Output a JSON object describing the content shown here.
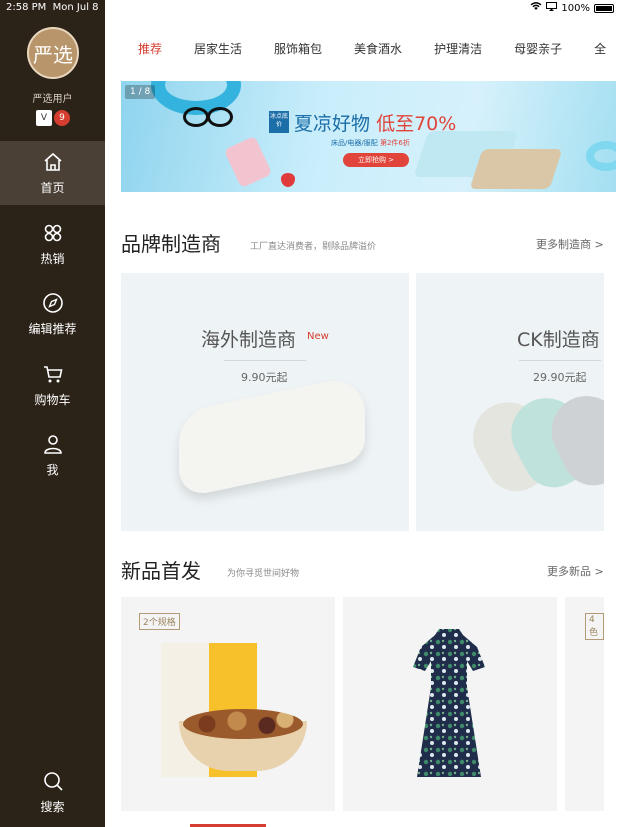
{
  "status_bar": {
    "time": "2:58 PM",
    "date": "Mon Jul 8",
    "battery": "100%"
  },
  "sidebar": {
    "avatar_text": "严选",
    "username": "严选用户",
    "badge_left": "V",
    "badge_right": "9",
    "items": [
      {
        "label": "首页",
        "icon": "home-icon",
        "active": true
      },
      {
        "label": "热销",
        "icon": "clover-icon",
        "active": false
      },
      {
        "label": "编辑推荐",
        "icon": "compass-icon",
        "active": false
      },
      {
        "label": "购物车",
        "icon": "cart-icon",
        "active": false
      },
      {
        "label": "我",
        "icon": "user-icon",
        "active": false
      }
    ],
    "search_label": "搜索"
  },
  "tabs": [
    "推荐",
    "居家生活",
    "服饰箱包",
    "美食酒水",
    "护理清洁",
    "母婴亲子",
    "全"
  ],
  "banner": {
    "counter": "1 / 8",
    "tag": "冰点底价",
    "title_main": "夏凉好物",
    "title_red": "低至70%",
    "subtitle": "床品/电器/服配",
    "subtitle_red": "第2件6折",
    "button": "立即抢购 >"
  },
  "brand_section": {
    "title": "品牌制造商",
    "subtitle": "工厂直达消费者，剔除品牌溢价",
    "more": "更多制造商 >",
    "cards": [
      {
        "name": "海外制造商",
        "badge": "New",
        "price": "9.90元起"
      },
      {
        "name": "CK制造商",
        "price": "29.90元起"
      }
    ]
  },
  "new_section": {
    "title": "新品首发",
    "subtitle": "为你寻觅世间好物",
    "more": "更多新品 >",
    "cards": [
      {
        "spec": "2个规格"
      },
      {
        "spec": ""
      },
      {
        "spec": "4色"
      }
    ]
  },
  "colors": {
    "sidebar_bg": "#2b2218",
    "accent": "#d43d2f"
  }
}
